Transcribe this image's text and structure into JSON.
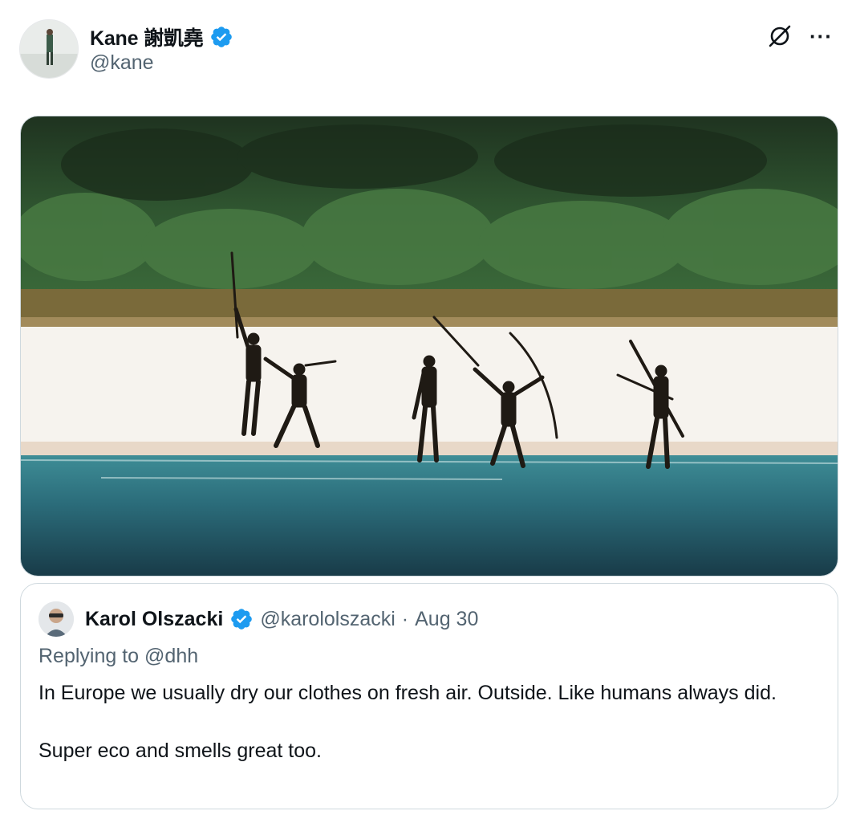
{
  "tweet": {
    "author": {
      "display_name": "Kane 謝凱堯",
      "handle": "@kane",
      "verified": true,
      "avatar": "avatar-photo"
    },
    "actions": {
      "grok_icon": "grok-icon",
      "more_icon": "more-icon",
      "more_label": "···"
    },
    "media": {
      "kind": "photo"
    }
  },
  "quoted_tweet": {
    "author": {
      "display_name": "Karol Olszacki",
      "handle": "@karololszacki",
      "verified": true,
      "avatar": "avatar-photo"
    },
    "separator": "·",
    "date": "Aug 30",
    "replying_to": {
      "prefix": "Replying to",
      "mention": "@dhh"
    },
    "body": {
      "line1": "In Europe we usually dry our clothes on fresh air. Outside. Like humans always did.",
      "line2": "Super eco and smells great too."
    }
  },
  "colors": {
    "verified_badge": "#1d9bf0",
    "secondary_text": "#536471",
    "border": "#cfd9de",
    "text": "#0f1419"
  }
}
